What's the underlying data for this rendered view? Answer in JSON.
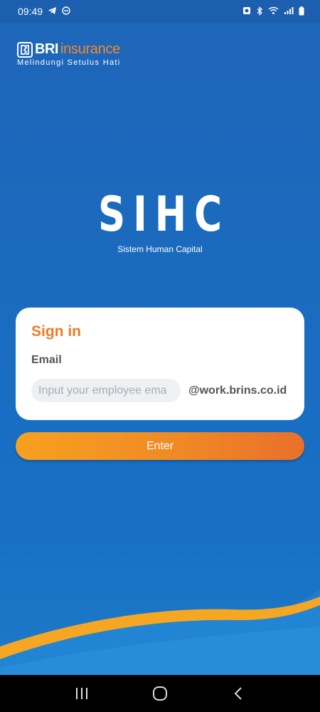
{
  "status_bar": {
    "time": "09:49",
    "icons_left": [
      "telegram-icon",
      "do-not-disturb-icon"
    ],
    "icons_right": [
      "alarm-icon",
      "bluetooth-icon",
      "wifi-icon",
      "signal-icon",
      "battery-icon"
    ]
  },
  "brand": {
    "name_bold": "BRI",
    "name_light": "insurance",
    "tagline": "Melindungi Setulus Hati"
  },
  "app": {
    "title": "SIHC",
    "subtitle": "Sistem Human Capital"
  },
  "sign_in": {
    "title": "Sign in",
    "email_label": "Email",
    "email_placeholder": "Input your employee ema",
    "email_value": "",
    "email_domain": "@work.brins.co.id",
    "enter_label": "Enter"
  },
  "nav_bar": {
    "buttons": [
      "recent-apps-icon",
      "home-icon",
      "back-icon"
    ]
  },
  "colors": {
    "background": "#1a6bbf",
    "accent_orange": "#f08a25",
    "card": "#ffffff",
    "title_orange": "#ec7c2a"
  }
}
